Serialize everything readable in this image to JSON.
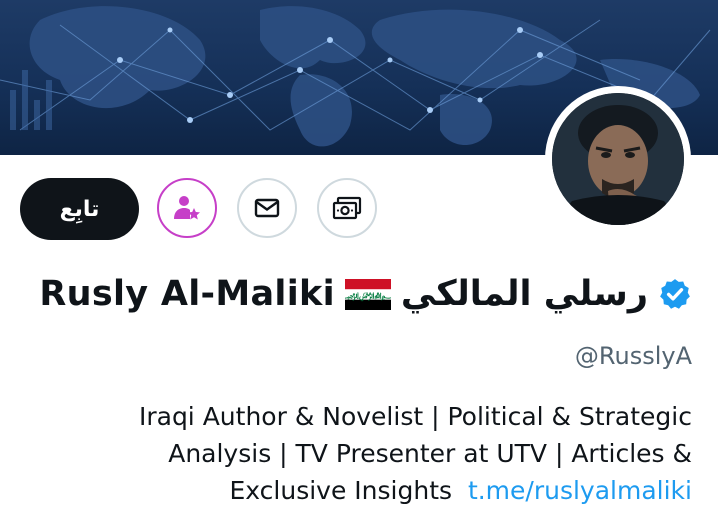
{
  "profile": {
    "name_latin": "Rusly Al-Maliki",
    "name_arabic": "رسلي المالكي",
    "flag": "iraq-flag-icon",
    "verified": "verified-badge-icon",
    "handle": "@RusslyA"
  },
  "actions": {
    "follow_label": "تابِع",
    "subscribe_icon": "person-star-icon",
    "message_icon": "mail-icon",
    "tip_icon": "money-icon"
  },
  "bio": {
    "line1": "Iraqi Author & Novelist | Political & Strategic",
    "line2": "Analysis | TV Presenter at UTV | Articles &",
    "line3_text": "Exclusive Insights",
    "link": "t.me/ruslyalmaliki"
  },
  "colors": {
    "accent": "#1d9bf0",
    "follow_bg": "#0f1419",
    "subscribe_purple": "#c63fc8",
    "secondary_text": "#536471"
  }
}
